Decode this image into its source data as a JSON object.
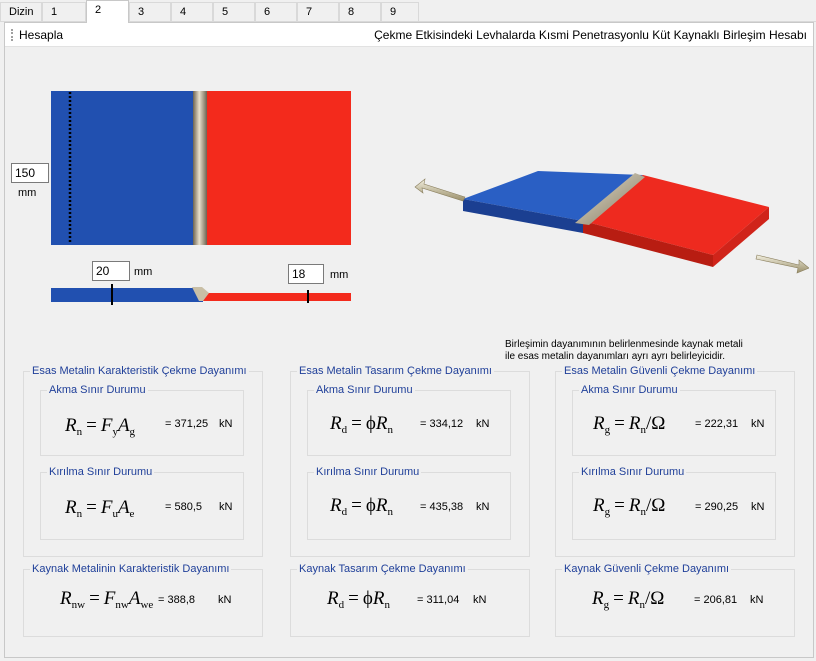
{
  "tabs": [
    "Dizin",
    "1",
    "2",
    "3",
    "4",
    "5",
    "6",
    "7",
    "8",
    "9"
  ],
  "toolbar": {
    "calculate_label": "Hesapla",
    "title": "Çekme Etkisindeki Levhalarda Kısmi Penetrasyonlu Küt Kaynaklı Birleşim Hesabı"
  },
  "inputs": {
    "width_value": "150",
    "width_unit": "mm",
    "thickness1_value": "20",
    "thickness1_unit": "mm",
    "thickness2_value": "18",
    "thickness2_unit": "mm"
  },
  "note": {
    "line1": "Birleşimin dayanımının belirlenmesinde kaynak metali",
    "line2": "ile esas metalin dayanımları ayrı ayrı belirleyicidir."
  },
  "colors": {
    "plate_blue": "#2150b0",
    "plate_red": "#f32a1c",
    "weld": "#b7ab8f",
    "group_title": "#1f3f99"
  },
  "groups": {
    "characteristic": {
      "title": "Esas Metalin Karakteristik Çekme Dayanımı",
      "yield_title": "Akma Sınır Durumu",
      "yield_value": "= 371,25",
      "rupture_title": "Kırılma Sınır Durumu",
      "rupture_value": "= 580,5"
    },
    "design": {
      "title": "Esas Metalin Tasarım Çekme Dayanımı",
      "yield_title": "Akma Sınır Durumu",
      "yield_value": "= 334,12",
      "rupture_title": "Kırılma Sınır Durumu",
      "rupture_value": "= 435,38"
    },
    "allowable": {
      "title": "Esas Metalin Güvenli Çekme Dayanımı",
      "yield_title": "Akma Sınır Durumu",
      "yield_value": "= 222,31",
      "rupture_title": "Kırılma Sınır Durumu",
      "rupture_value": "= 290,25"
    },
    "weld_characteristic": {
      "title": "Kaynak Metalinin Karakteristik Dayanımı",
      "value": "= 388,8"
    },
    "weld_design": {
      "title": "Kaynak Tasarım Çekme Dayanımı",
      "value": "= 311,04"
    },
    "weld_allowable": {
      "title": "Kaynak Güvenli Çekme Dayanımı",
      "value": "= 206,81"
    }
  },
  "unit_kn": "kN",
  "formulas": {
    "Rn_yield": {
      "lhs": "R",
      "lhs_sub": "n",
      "a": "F",
      "a_sub": "y",
      "b": "A",
      "b_sub": "g"
    },
    "Rn_rupture": {
      "lhs": "R",
      "lhs_sub": "n",
      "a": "F",
      "a_sub": "u",
      "b": "A",
      "b_sub": "e"
    },
    "Rd": {
      "lhs": "R",
      "lhs_sub": "d",
      "phi": "ϕ",
      "r": "R",
      "r_sub": "n"
    },
    "Rg": {
      "lhs": "R",
      "lhs_sub": "g",
      "r": "R",
      "r_sub": "n",
      "slash": "/",
      "omega": "Ω"
    },
    "Rnw": {
      "lhs": "R",
      "lhs_sub": "nw",
      "a": "F",
      "a_sub": "nw",
      "b": "A",
      "b_sub": "we"
    }
  }
}
